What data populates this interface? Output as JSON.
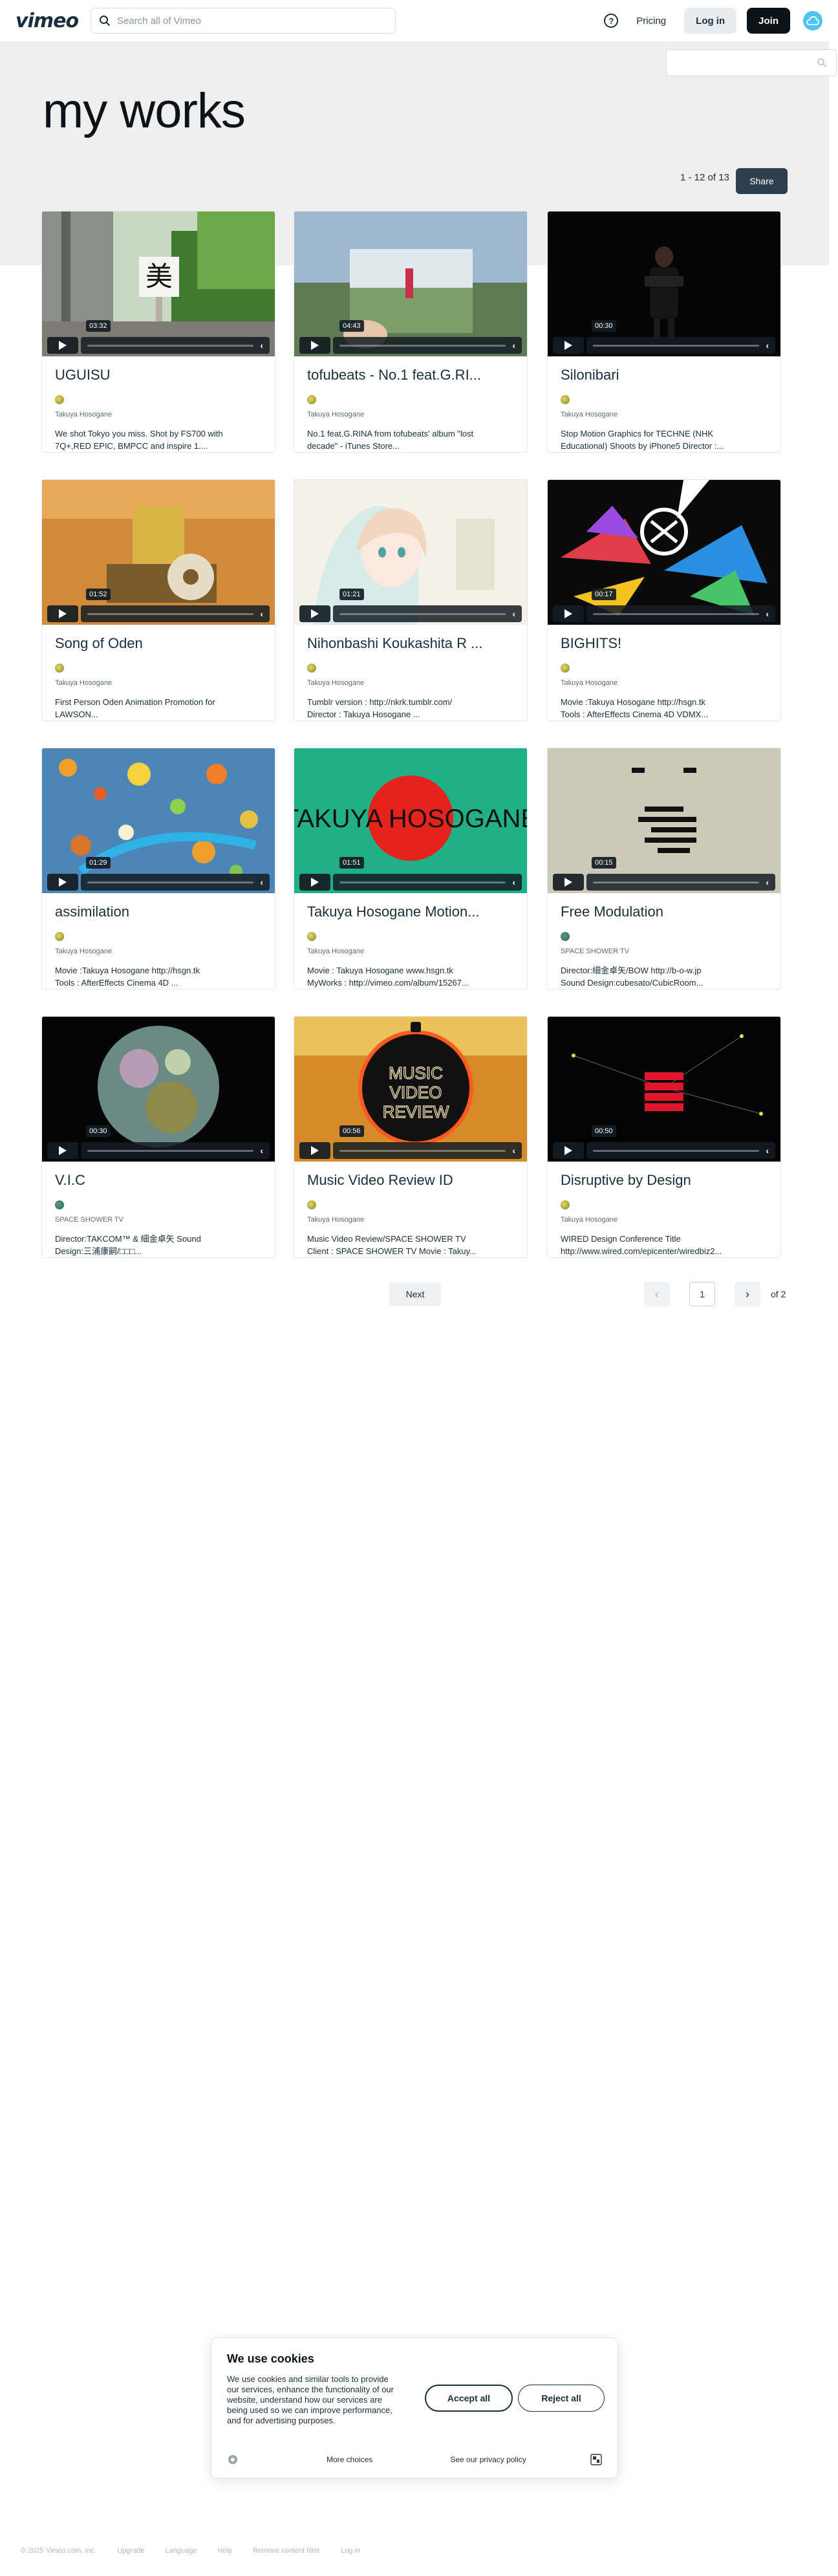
{
  "header": {
    "logo": "vimeo",
    "search_placeholder": "Search all of Vimeo",
    "pricing": "Pricing",
    "login": "Log in",
    "join": "Join"
  },
  "page": {
    "title": "my works",
    "counter": "1 - 12 of 13",
    "share": "Share"
  },
  "videos": [
    {
      "title": "UGUISU",
      "owner": "Takuya Hosogane",
      "duration": "03:32",
      "desc1": "We shot Tokyo you miss. Shot by FS700 with",
      "desc2": "7Q+,RED EPIC, BMPCC and inspire 1...."
    },
    {
      "title": "tofubeats - No.1 feat.G.RI...",
      "owner": "Takuya Hosogane",
      "duration": "04:43",
      "desc1": "No.1 feat.G.RINA from tofubeats' album \"lost",
      "desc2": "decade\"  - iTunes Store..."
    },
    {
      "title": "Silonibari",
      "owner": "Takuya Hosogane",
      "duration": "00:30",
      "desc1": "Stop Motion Graphics for TECHNE (NHK",
      "desc2": "Educational) Shoots by iPhone5 Director :..."
    },
    {
      "title": "Song of Oden",
      "owner": "Takuya Hosogane",
      "duration": "01:52",
      "desc1": "First Person Oden Animation Promotion for",
      "desc2": "LAWSON..."
    },
    {
      "title": "Nihonbashi Koukashita R ...",
      "owner": "Takuya Hosogane",
      "duration": "01:21",
      "desc1": "Tumblr version : http://nkrk.tumblr.com/",
      "desc2": "Director : Takuya Hosogane    ..."
    },
    {
      "title": "BIGHITS!",
      "owner": "Takuya Hosogane",
      "duration": "00:17",
      "desc1": "Movie :Takuya Hosogane http://hsgn.tk",
      "desc2": "Tools : AfterEffects Cinema 4D VDMX..."
    },
    {
      "title": "assimilation",
      "owner": "Takuya Hosogane",
      "duration": "01:29",
      "desc1": "Movie :Takuya Hosogane http://hsgn.tk",
      "desc2": "Tools : AfterEffects Cinema 4D    ..."
    },
    {
      "title": "Takuya Hosogane Motion...",
      "owner": "Takuya Hosogane",
      "duration": "01:51",
      "desc1": "Movie : Takuya Hosogane www.hsgn.tk",
      "desc2": "MyWorks : http://vimeo.com/album/15267..."
    },
    {
      "title": "Free Modulation",
      "owner": "SPACE SHOWER TV",
      "duration": "00:15",
      "desc1": "Director:細金卓矢/BOW http://b-o-w.jp",
      "desc2": "Sound Design:cubesato/CubicRoom..."
    },
    {
      "title": "V.I.C",
      "owner": "SPACE SHOWER TV",
      "duration": "00:30",
      "desc1": "Director:TAKCOM™ & 細金卓矢 Sound",
      "desc2": "Design:三浦康嗣/□□□..."
    },
    {
      "title": "Music Video Review ID",
      "owner": "Takuya Hosogane",
      "duration": "00:56",
      "desc1": "Music Video Review/SPACE SHOWER TV",
      "desc2": "Client : SPACE SHOWER TV Movie : Takuy..."
    },
    {
      "title": "Disruptive by Design",
      "owner": "Takuya Hosogane",
      "duration": "00:50",
      "desc1": "WIRED Design Conference Title",
      "desc2": "http://www.wired.com/epicenter/wiredbiz2..."
    }
  ],
  "thumb_text": {
    "takuya": "TAKUYA HOSOGANE",
    "mvr1": "MUSIC",
    "mvr2": "VIDEO",
    "mvr3": "REVIEW",
    "kanji": "美"
  },
  "pagination": {
    "next": "Next",
    "page": "1",
    "of": "of 2"
  },
  "cookies": {
    "title": "We use cookies",
    "body": "We use cookies and similar tools to provide our services, enhance the functionality of our website, understand how our services are being used so we can improve performance, and for advertising purposes.",
    "accept": "Accept all",
    "reject": "Reject all",
    "more": "More choices",
    "privacy": "See our privacy policy"
  },
  "footer": {
    "copyright": "© 2025 Vimeo.com, Inc.",
    "upgrade": "Upgrade",
    "language": "Language",
    "help": "Help",
    "remove": "Remove content filter",
    "login": "Log in"
  },
  "colors": {
    "brand": "#1a2e3b",
    "share_button": "#2d3e4e",
    "hero_background": "#efefef",
    "join_button": "#0b1218",
    "avatar": "#4fc3f7"
  }
}
